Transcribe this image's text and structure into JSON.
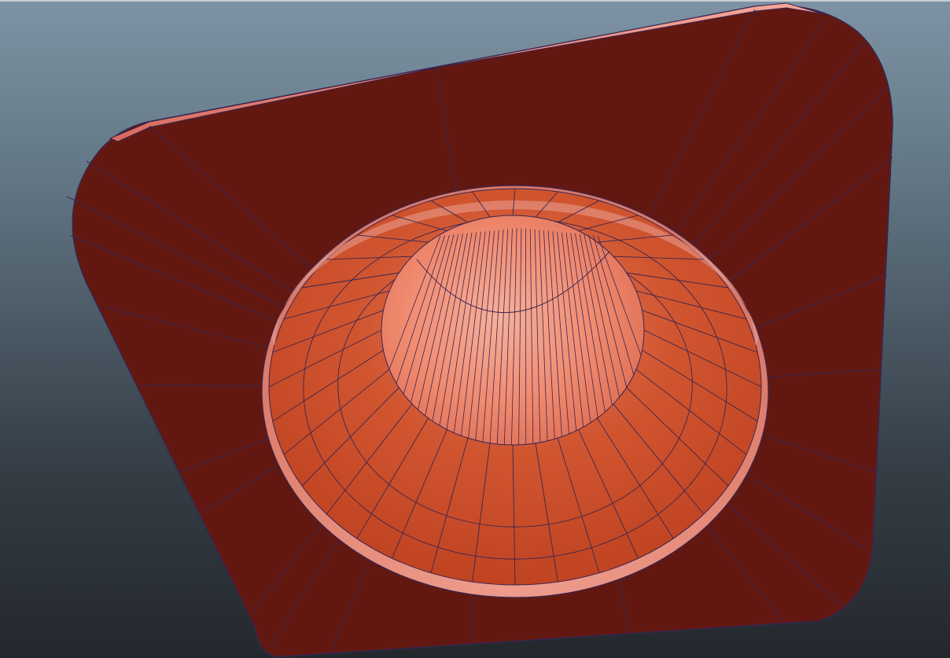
{
  "viewport": {
    "panel": "viewport",
    "mode": "textured-wireframe-on-shaded"
  },
  "colors": {
    "background_top": "#7d93a3",
    "background_bottom": "#23282d",
    "base_face": "#621811",
    "rim": "#e67a6e",
    "flange": "#c5492a",
    "dome": "#f08f75",
    "wire": "#3a2550"
  },
  "mesh": {
    "object": "cone-on-rounded-plate",
    "ring_segments": 36
  }
}
